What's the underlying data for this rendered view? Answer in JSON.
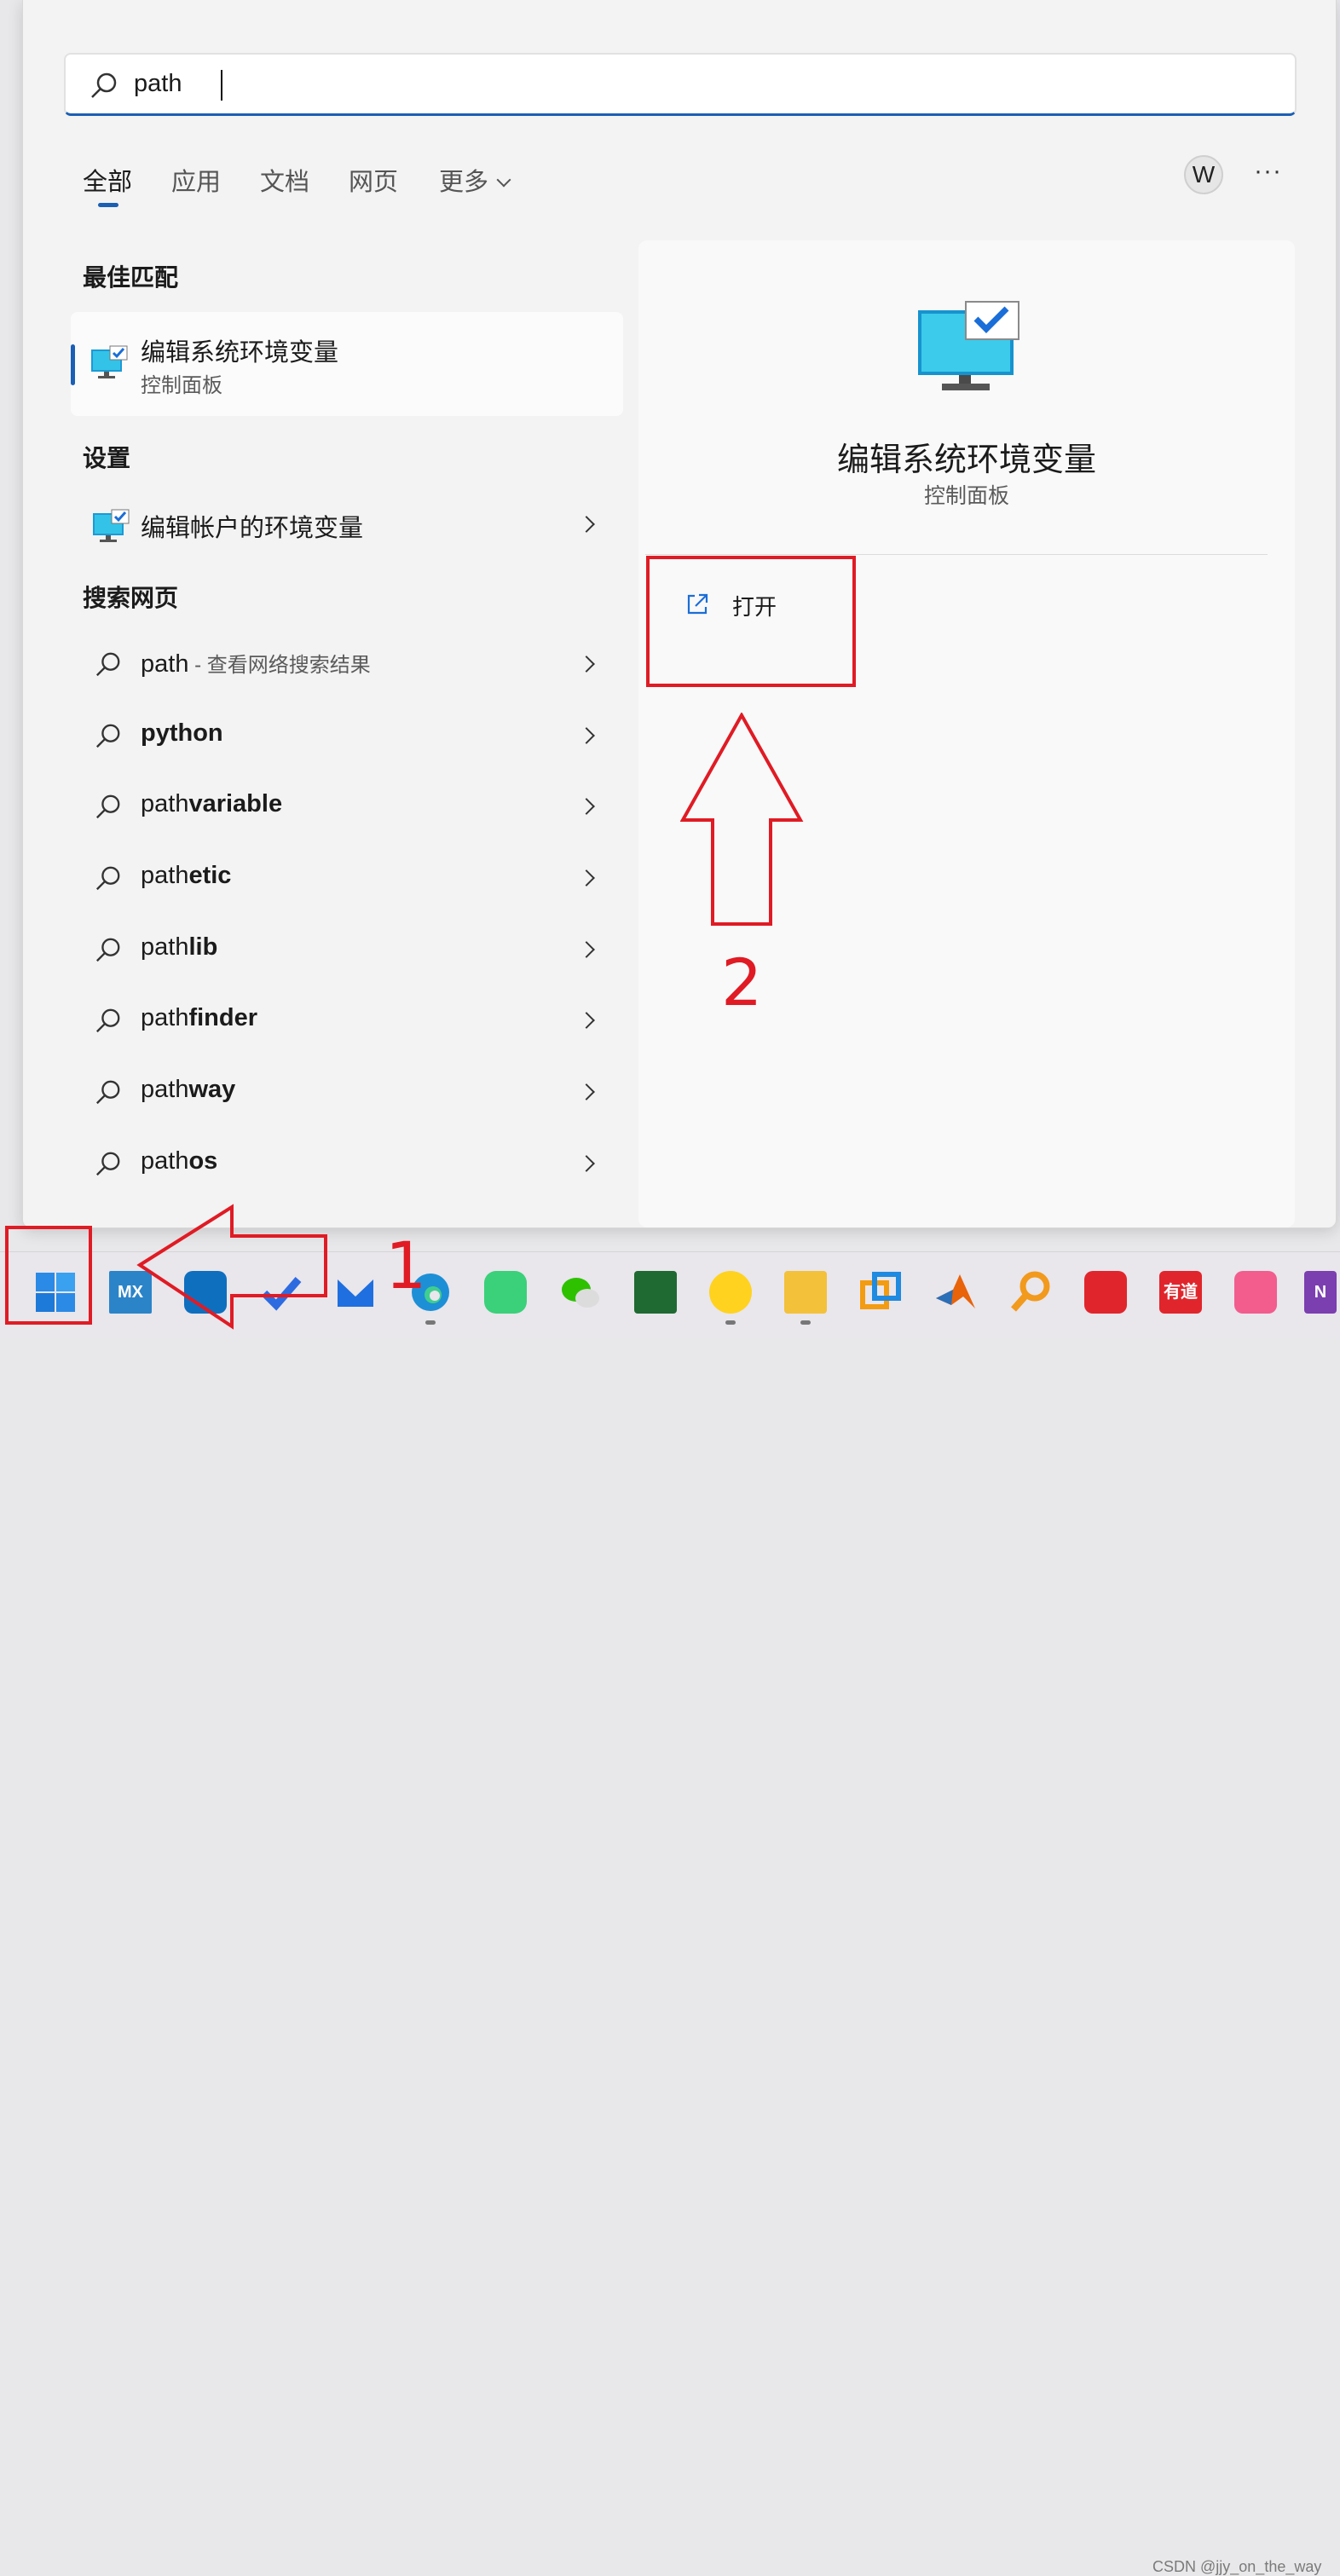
{
  "search": {
    "query": "path"
  },
  "tabs": [
    {
      "label": "全部",
      "active": true
    },
    {
      "label": "应用",
      "active": false
    },
    {
      "label": "文档",
      "active": false
    },
    {
      "label": "网页",
      "active": false
    },
    {
      "label": "更多",
      "active": false
    }
  ],
  "account": {
    "initial": "W"
  },
  "more_menu": "···",
  "best_match": {
    "section": "最佳匹配",
    "title": "编辑系统环境变量",
    "subtitle": "控制面板"
  },
  "settings": {
    "section": "设置",
    "item": "编辑帐户的环境变量"
  },
  "web": {
    "section": "搜索网页",
    "first": {
      "prefix": "path",
      "suffix": " - 查看网络搜索结果"
    },
    "suggestions": [
      {
        "prefix": "",
        "bold": "python"
      },
      {
        "prefix": "path",
        "bold": "variable"
      },
      {
        "prefix": "path",
        "bold": "etic"
      },
      {
        "prefix": "path",
        "bold": "lib"
      },
      {
        "prefix": "path",
        "bold": "finder"
      },
      {
        "prefix": "path",
        "bold": "way"
      },
      {
        "prefix": "path",
        "bold": "os"
      }
    ]
  },
  "detail": {
    "title": "编辑系统环境变量",
    "subtitle": "控制面板",
    "action": "打开"
  },
  "annotations": {
    "step1": "1",
    "step2": "2"
  },
  "taskbar": {
    "apps": [
      "start",
      "MX",
      "app-blue",
      "todo",
      "mail",
      "edge",
      "app-green",
      "wechat",
      "vim",
      "qqmusic",
      "explorer",
      "vmware",
      "matlab",
      "everything",
      "netease",
      "有道",
      "bilibili",
      "N"
    ]
  },
  "watermark": "CSDN @jjy_on_the_way",
  "colors": {
    "accent": "#1a5fb4",
    "annotation": "#e01b24"
  }
}
